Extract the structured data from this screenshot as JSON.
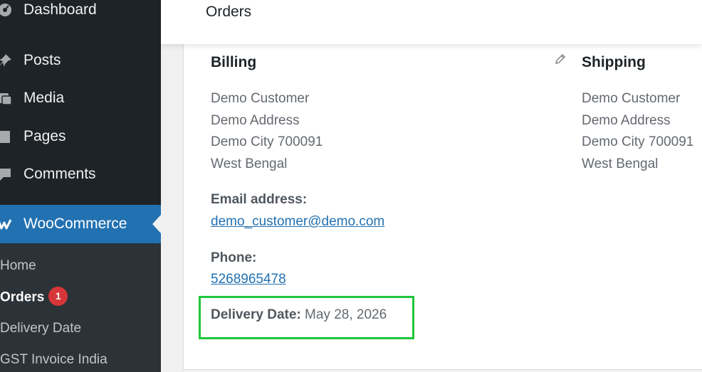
{
  "sidebar": {
    "items": [
      {
        "label": "Dashboard",
        "icon": "dashboard-icon"
      },
      {
        "label": "Posts",
        "icon": "pin-icon"
      },
      {
        "label": "Media",
        "icon": "media-icon"
      },
      {
        "label": "Pages",
        "icon": "pages-icon"
      },
      {
        "label": "Comments",
        "icon": "comments-icon"
      },
      {
        "label": "WooCommerce",
        "icon": "woocommerce-icon",
        "active": true
      }
    ],
    "submenu": [
      {
        "label": "Home"
      },
      {
        "label": "Orders",
        "badge": "1",
        "current": true
      },
      {
        "label": "Delivery Date"
      },
      {
        "label": "GST Invoice India"
      }
    ]
  },
  "header": {
    "title": "Orders"
  },
  "billing": {
    "title": "Billing",
    "lines": [
      "Demo Customer",
      "Demo Address",
      "Demo City 700091",
      "West Bengal"
    ],
    "email_label": "Email address:",
    "email": "demo_customer@demo.com",
    "phone_label": "Phone:",
    "phone": "5268965478",
    "delivery_label": "Delivery Date:",
    "delivery_value": "May 28, 2026"
  },
  "shipping": {
    "title": "Shipping",
    "lines": [
      "Demo Customer",
      "Demo Address",
      "Demo City 700091",
      "West Bengal"
    ]
  },
  "colors": {
    "accent": "#2271b1",
    "sidebar": "#1d2327",
    "badge": "#d63638",
    "highlight": "#1fc63a"
  }
}
